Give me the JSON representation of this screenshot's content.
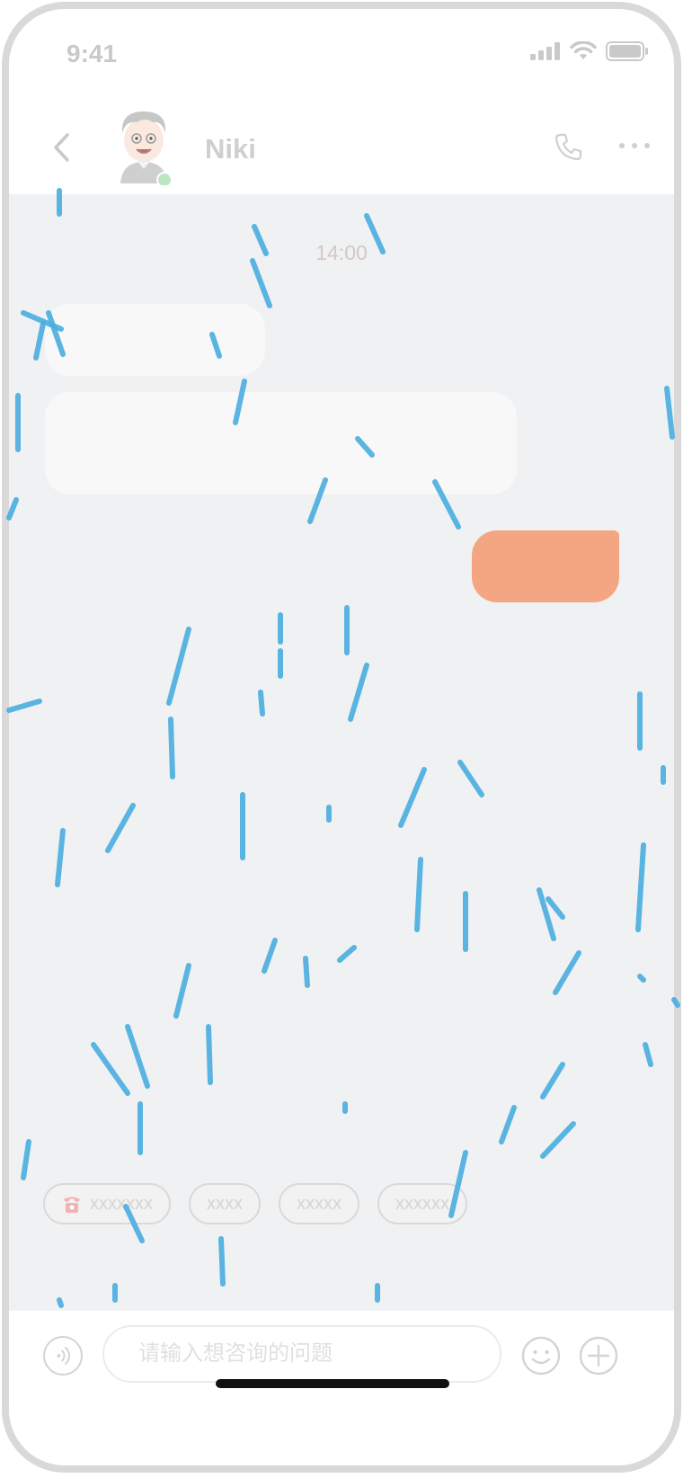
{
  "status_bar": {
    "time": "9:41"
  },
  "header": {
    "contact_name": "Niki",
    "online": true
  },
  "chat": {
    "timestamp": "14:00",
    "messages": [
      {
        "side": "left",
        "text": ""
      },
      {
        "side": "left",
        "text": ""
      },
      {
        "side": "right",
        "text": ""
      }
    ]
  },
  "quick_replies": [
    {
      "label": "xxxxxxx",
      "icon": "phone-icon"
    },
    {
      "label": "xxxx"
    },
    {
      "label": "xxxxx"
    },
    {
      "label": "xxxxxx"
    }
  ],
  "input": {
    "placeholder": "请输入想咨询的问题",
    "value": ""
  },
  "colors": {
    "accent_bubble": "#f4a683",
    "chat_background": "#f0f1f3",
    "rain_overlay": "#4aaee0",
    "online_dot": "#bfe6c4"
  }
}
